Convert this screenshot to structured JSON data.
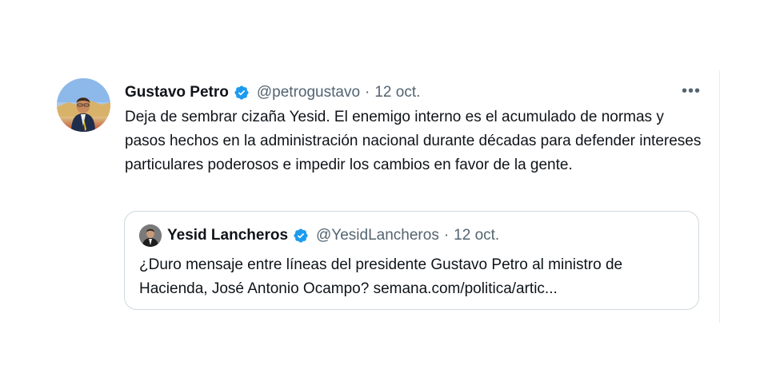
{
  "tweet": {
    "author_name": "Gustavo Petro",
    "handle": "@petrogustavo",
    "separator": "·",
    "date": "12 oct.",
    "text": "Deja de sembrar cizaña Yesid. El enemigo interno es el acumulado de normas y pasos hechos en la administración nacional durante décadas para defender intereses particulares poderosos e impedir los cambios en favor de la gente.",
    "more_label": "•••",
    "verified": true
  },
  "quoted_tweet": {
    "author_name": "Yesid Lancheros",
    "handle": "@YesidLancheros",
    "separator": "·",
    "date": "12 oct.",
    "text": "¿Duro mensaje entre líneas del presidente Gustavo Petro al ministro de Hacienda, José Antonio Ocampo? semana.com/politica/artic...",
    "verified": true
  },
  "colors": {
    "verified_badge": "#1d9bf0",
    "secondary_text": "#536471",
    "border": "#cfd9de"
  }
}
